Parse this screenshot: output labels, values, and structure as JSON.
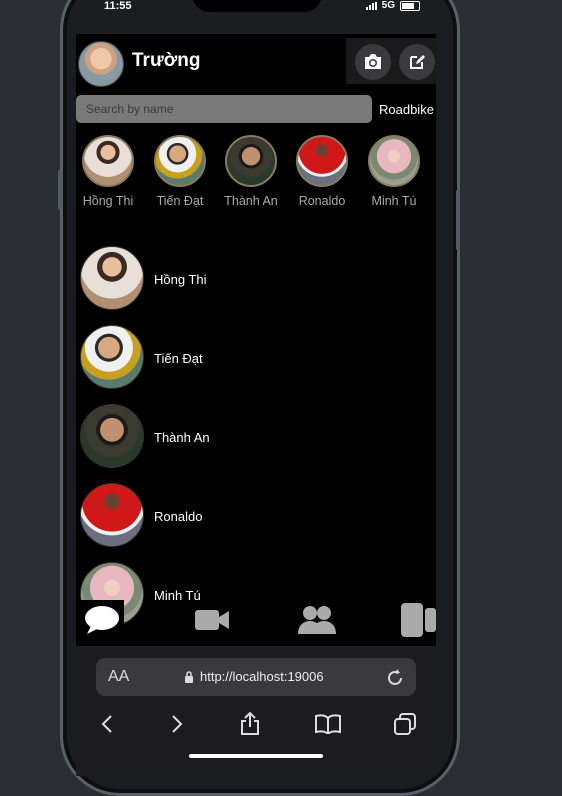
{
  "status": {
    "time": "11:55",
    "network": "5G"
  },
  "header": {
    "title": "Trường"
  },
  "search": {
    "placeholder": "Search by name",
    "filter_label": "Roadbike"
  },
  "stories": [
    {
      "name": "Hồng Thi"
    },
    {
      "name": "Tiến Đạt"
    },
    {
      "name": "Thành An"
    },
    {
      "name": "Ronaldo"
    },
    {
      "name": "Minh Tú"
    }
  ],
  "conversations": [
    {
      "name": "Hồng Thi"
    },
    {
      "name": "Tiến Đạt"
    },
    {
      "name": "Thành An"
    },
    {
      "name": "Ronaldo"
    },
    {
      "name": "Minh Tú"
    }
  ],
  "tabs": [
    {
      "icon": "chat-bubble-icon"
    },
    {
      "icon": "video-camera-icon"
    },
    {
      "icon": "people-icon"
    },
    {
      "icon": "stories-icon"
    }
  ],
  "browser": {
    "text_size_label": "AA",
    "url": "http://localhost:19006"
  },
  "colors": {
    "background": "#000000",
    "search_bg": "#7a7a7a",
    "browser_bar": "#1c1c1e"
  }
}
